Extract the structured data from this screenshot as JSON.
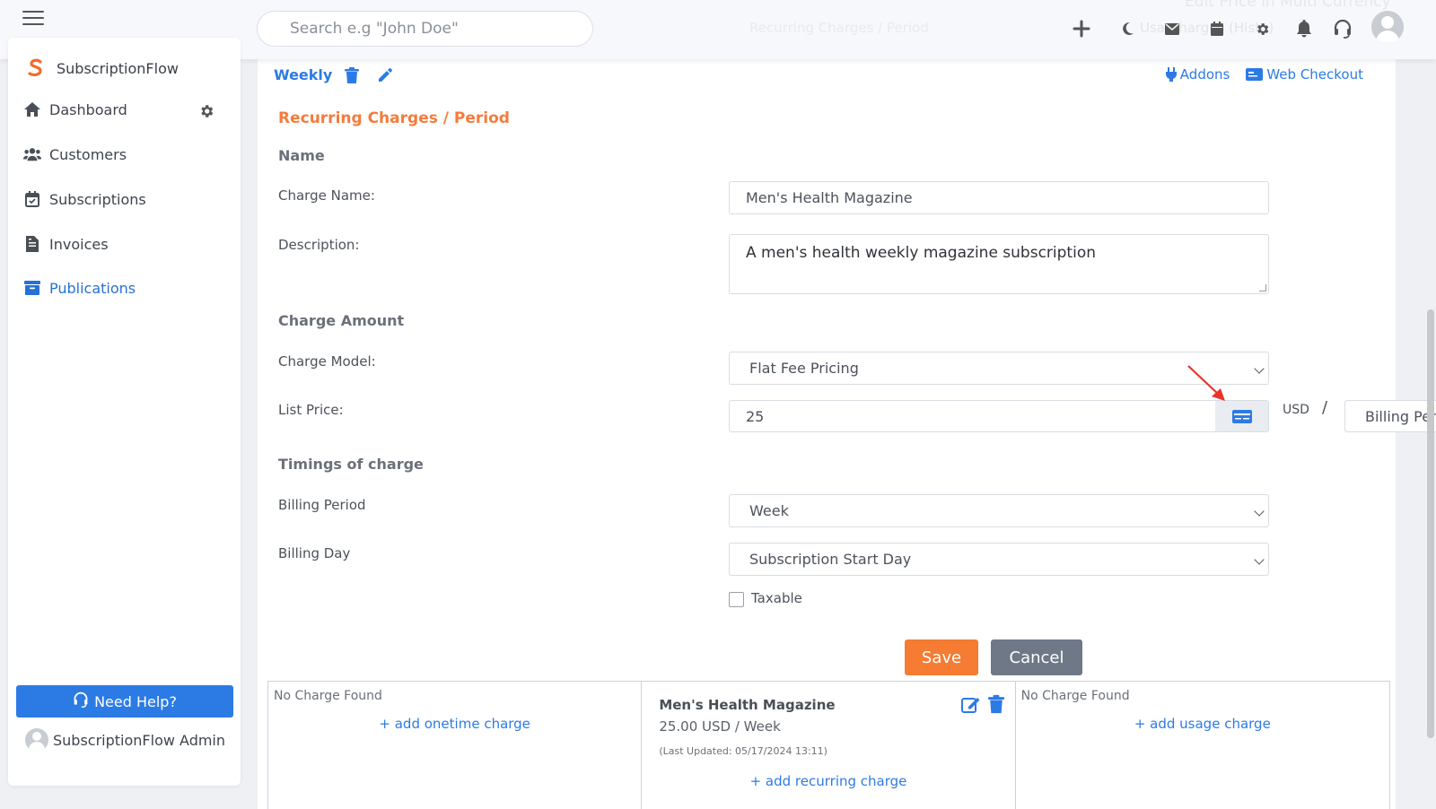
{
  "topbar": {
    "search_placeholder": "Search e.g \"John Doe\"",
    "ghost_breadcrumb": "Recurring Charges / Period",
    "ghost_right": "Usa Charges (Histo)",
    "ghost_top": "Edit Price in Multi Currency"
  },
  "sidebar": {
    "brand": "SubscriptionFlow",
    "items": [
      {
        "label": "Dashboard",
        "icon": "home-icon"
      },
      {
        "label": "Customers",
        "icon": "users-icon"
      },
      {
        "label": "Subscriptions",
        "icon": "calendar-check-icon"
      },
      {
        "label": "Invoices",
        "icon": "invoice-icon"
      },
      {
        "label": "Publications",
        "icon": "archive-icon",
        "active": true
      }
    ],
    "help_label": "Need Help?",
    "admin_name": "SubscriptionFlow Admin"
  },
  "header": {
    "plan_name": "Weekly",
    "addons_label": "Addons",
    "web_checkout_label": "Web Checkout"
  },
  "form": {
    "section_title": "Recurring Charges / Period",
    "name_group": "Name",
    "charge_name_label": "Charge Name:",
    "charge_name_value": "Men's Health Magazine",
    "description_label": "Description:",
    "description_value": "A men's health weekly magazine subscription",
    "amount_group": "Charge Amount",
    "charge_model_label": "Charge Model:",
    "charge_model_value": "Flat Fee Pricing",
    "list_price_label": "List Price:",
    "list_price_value": "25",
    "currency": "USD",
    "slash": "/",
    "per_value": "Billing Period",
    "timing_group": "Timings of charge",
    "billing_period_label": "Billing Period",
    "billing_period_value": "Week",
    "billing_day_label": "Billing Day",
    "billing_day_value": "Subscription Start Day",
    "taxable_label": "Taxable",
    "save_label": "Save",
    "cancel_label": "Cancel"
  },
  "charges": {
    "onetime_empty": "No Charge Found",
    "onetime_add": "+ add onetime charge",
    "recurring_name": "Men's Health Magazine",
    "recurring_price": "25.00 USD / Week",
    "recurring_updated": "(Last Updated: 05/17/2024 13:11)",
    "recurring_add": "+ add recurring charge",
    "usage_empty": "No Charge Found",
    "usage_add": "+ add usage charge"
  },
  "colors": {
    "accent": "#2c7be5",
    "orange": "#f57c32",
    "section_title": "#f47c3c",
    "cancel": "#6e7887",
    "annotation_arrow": "#e8352b"
  }
}
